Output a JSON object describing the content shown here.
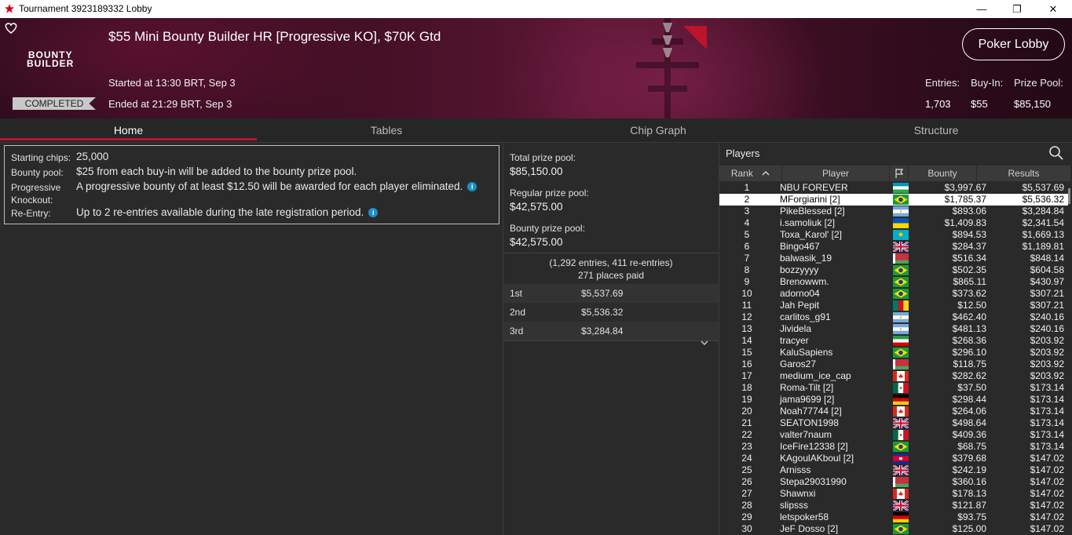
{
  "window": {
    "title": "Tournament 3923189332 Lobby",
    "minimize": "—",
    "maximize": "❐",
    "close": "✕"
  },
  "banner": {
    "brand_line1": "BOUNTY",
    "brand_line2": "BUILDER",
    "tournament_name": "$55 Mini Bounty Builder HR [Progressive KO], $70K Gtd",
    "started": "Started at 13:30 BRT, Sep 3",
    "ended": "Ended at 21:29 BRT, Sep 3",
    "status": "COMPLETED",
    "lobby_button": "Poker Lobby",
    "stats": {
      "entries_label": "Entries:",
      "entries_value": "1,703",
      "buyin_label": "Buy-In:",
      "buyin_value": "$55",
      "prizepool_label": "Prize Pool:",
      "prizepool_value": "$85,150"
    }
  },
  "tabs": [
    "Home",
    "Tables",
    "Chip Graph",
    "Structure"
  ],
  "info": {
    "starting_chips_label": "Starting chips:",
    "starting_chips_value": "25,000",
    "bounty_pool_label": "Bounty pool:",
    "bounty_pool_value": "$25 from each buy-in will be added to the bounty prize pool.",
    "pk_label_1": "Progressive",
    "pk_label_2": "Knockout:",
    "pk_value": "A progressive bounty of at least $12.50 will be awarded for each player eliminated.",
    "reentry_label": "Re-Entry:",
    "reentry_value": "Up to 2 re-entries available during the late registration period."
  },
  "prize": {
    "total_label": "Total prize pool:",
    "total_value": "$85,150.00",
    "regular_label": "Regular prize pool:",
    "regular_value": "$42,575.00",
    "bounty_label": "Bounty prize pool:",
    "bounty_value": "$42,575.00",
    "entries_note": "(1,292 entries, 411 re-entries)",
    "places_paid": "271 places paid",
    "places": [
      {
        "place": "1st",
        "amount": "$5,537.69"
      },
      {
        "place": "2nd",
        "amount": "$5,536.32"
      },
      {
        "place": "3rd",
        "amount": "$3,284.84"
      }
    ]
  },
  "players": {
    "title": "Players",
    "headers": {
      "rank": "Rank",
      "player": "Player",
      "bounty": "Bounty",
      "results": "Results"
    },
    "rows": [
      {
        "rank": "1",
        "name": "NBU FOREVER",
        "flag": "uz",
        "bounty": "$3,997.67",
        "result": "$5,537.69"
      },
      {
        "rank": "2",
        "name": "MForgiarini [2]",
        "flag": "br",
        "bounty": "$1,785.37",
        "result": "$5,536.32"
      },
      {
        "rank": "3",
        "name": "PikeBlessed [2]",
        "flag": "ar",
        "bounty": "$893.06",
        "result": "$3,284.84"
      },
      {
        "rank": "4",
        "name": "i.samoliuk [2]",
        "flag": "ua",
        "bounty": "$1,409.83",
        "result": "$2,341.54"
      },
      {
        "rank": "5",
        "name": "Toxa_Karol' [2]",
        "flag": "kz",
        "bounty": "$894.53",
        "result": "$1,669.13"
      },
      {
        "rank": "6",
        "name": "Bingo467",
        "flag": "gb",
        "bounty": "$284.37",
        "result": "$1,189.81"
      },
      {
        "rank": "7",
        "name": "balwasik_19",
        "flag": "by",
        "bounty": "$516.34",
        "result": "$848.14"
      },
      {
        "rank": "8",
        "name": "bozzyyyy",
        "flag": "br",
        "bounty": "$502.35",
        "result": "$604.58"
      },
      {
        "rank": "9",
        "name": "Brenowwm.",
        "flag": "br",
        "bounty": "$865.11",
        "result": "$430.97"
      },
      {
        "rank": "10",
        "name": "adorno04",
        "flag": "br",
        "bounty": "$373.62",
        "result": "$307.21"
      },
      {
        "rank": "11",
        "name": "Jah Pepit",
        "flag": "cm",
        "bounty": "$12.50",
        "result": "$307.21"
      },
      {
        "rank": "12",
        "name": "carlitos_g91",
        "flag": "ar",
        "bounty": "$462.40",
        "result": "$240.16"
      },
      {
        "rank": "13",
        "name": "Jividela",
        "flag": "ar",
        "bounty": "$481.13",
        "result": "$240.16"
      },
      {
        "rank": "14",
        "name": "tracyer",
        "flag": "ir",
        "bounty": "$268.36",
        "result": "$203.92"
      },
      {
        "rank": "15",
        "name": "KaluSapiens",
        "flag": "br",
        "bounty": "$296.10",
        "result": "$203.92"
      },
      {
        "rank": "16",
        "name": "Garos27",
        "flag": "by",
        "bounty": "$118.75",
        "result": "$203.92"
      },
      {
        "rank": "17",
        "name": "medium_ice_cap",
        "flag": "ca",
        "bounty": "$282.62",
        "result": "$203.92"
      },
      {
        "rank": "18",
        "name": "Roma-Tilt [2]",
        "flag": "mx",
        "bounty": "$37.50",
        "result": "$173.14"
      },
      {
        "rank": "19",
        "name": "jama9699 [2]",
        "flag": "de",
        "bounty": "$298.44",
        "result": "$173.14"
      },
      {
        "rank": "20",
        "name": "Noah77744 [2]",
        "flag": "ca",
        "bounty": "$264.06",
        "result": "$173.14"
      },
      {
        "rank": "21",
        "name": "SEATON1998",
        "flag": "gb",
        "bounty": "$498.64",
        "result": "$173.14"
      },
      {
        "rank": "22",
        "name": "valter7naum",
        "flag": "mx",
        "bounty": "$409.36",
        "result": "$173.14"
      },
      {
        "rank": "23",
        "name": "IceFire12338 [2]",
        "flag": "br",
        "bounty": "$68.75",
        "result": "$173.14"
      },
      {
        "rank": "24",
        "name": "KAgoulAKboul [2]",
        "flag": "kh",
        "bounty": "$379.68",
        "result": "$147.02"
      },
      {
        "rank": "25",
        "name": "Arnisss",
        "flag": "gb",
        "bounty": "$242.19",
        "result": "$147.02"
      },
      {
        "rank": "26",
        "name": "Stepa29031990",
        "flag": "by",
        "bounty": "$360.16",
        "result": "$147.02"
      },
      {
        "rank": "27",
        "name": "Shawnxi",
        "flag": "ca",
        "bounty": "$178.13",
        "result": "$147.02"
      },
      {
        "rank": "28",
        "name": "slipsss",
        "flag": "gb",
        "bounty": "$121.87",
        "result": "$147.02"
      },
      {
        "rank": "29",
        "name": "letspoker58",
        "flag": "de",
        "bounty": "$93.75",
        "result": "$147.02"
      },
      {
        "rank": "30",
        "name": "JeF Dosso [2]",
        "flag": "br",
        "bounty": "$125.00",
        "result": "$147.02"
      }
    ],
    "selected_rank": "2"
  },
  "colors": {
    "accent": "#c0102e",
    "banner_dark": "#2a0c1c",
    "panel": "#2a2a2a",
    "info_icon": "#1c8fc9"
  }
}
